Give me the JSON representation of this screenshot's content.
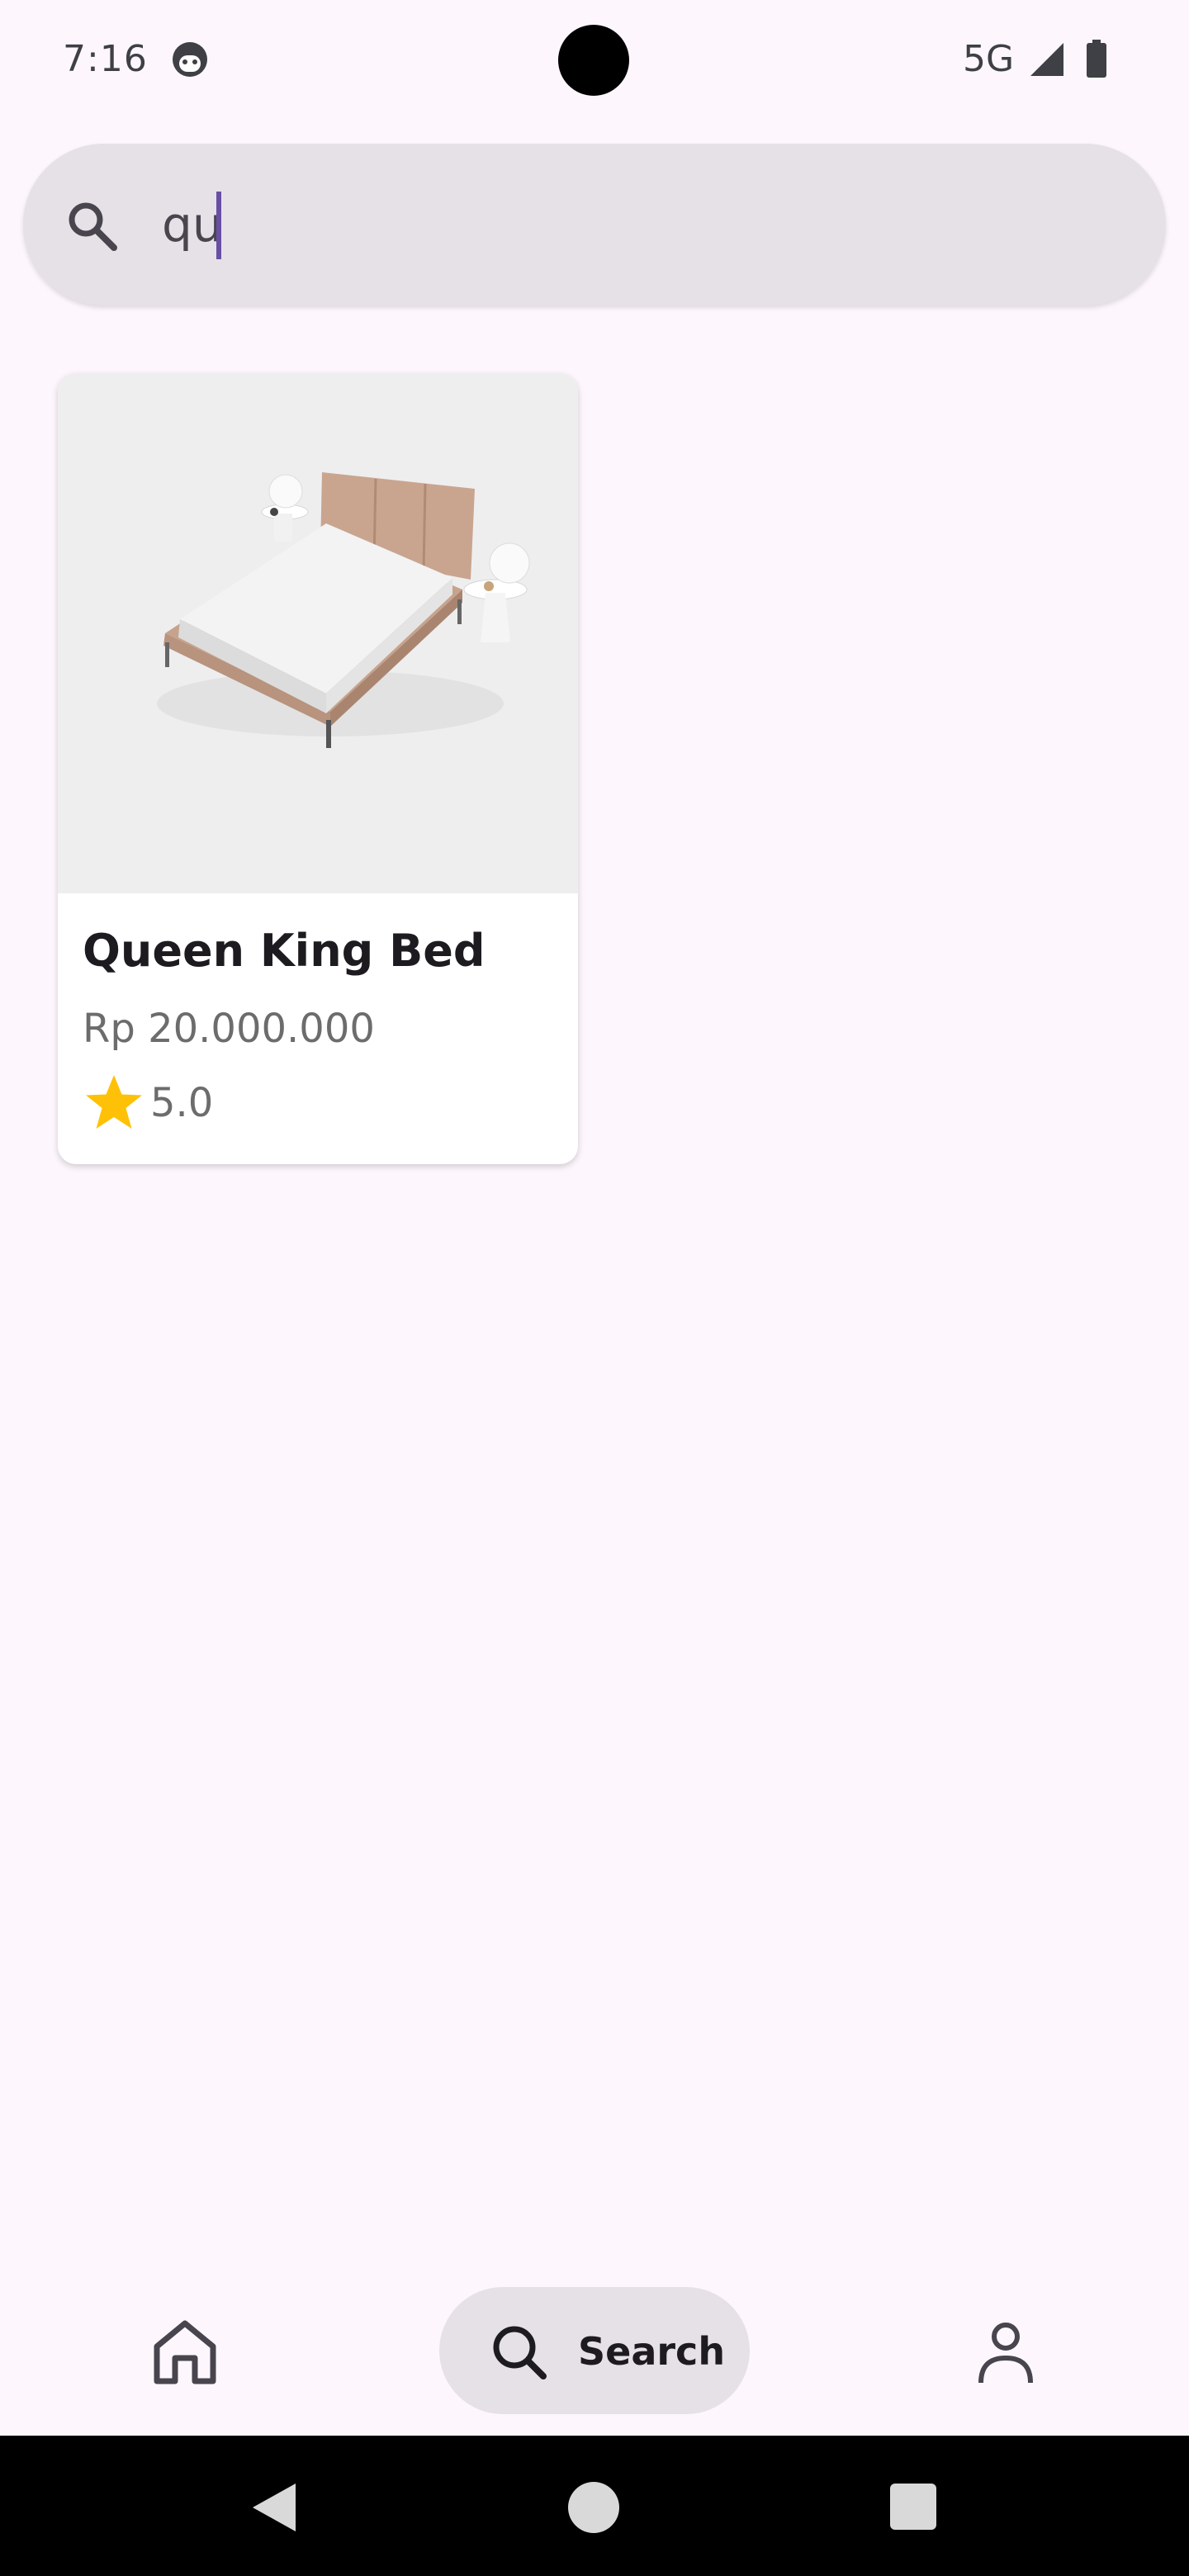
{
  "status_bar": {
    "time": "7:16",
    "network": "5G",
    "app_icon": "face-icon",
    "signal_icon": "signal-icon",
    "battery_icon": "battery-icon"
  },
  "search": {
    "value": "qu",
    "icon": "search-icon",
    "accent_color": "#6750a4"
  },
  "results": [
    {
      "name": "Queen King Bed",
      "price": "Rp 20.000.000",
      "rating": "5.0",
      "rating_icon": "star-icon",
      "rating_color": "#ffc107"
    }
  ],
  "bottom_nav": {
    "home_icon": "home-icon",
    "search_label": "Search",
    "search_icon": "search-icon",
    "profile_icon": "person-icon"
  },
  "system_nav": {
    "back_icon": "back-icon",
    "home_icon": "home-circle-icon",
    "recents_icon": "recents-icon"
  }
}
